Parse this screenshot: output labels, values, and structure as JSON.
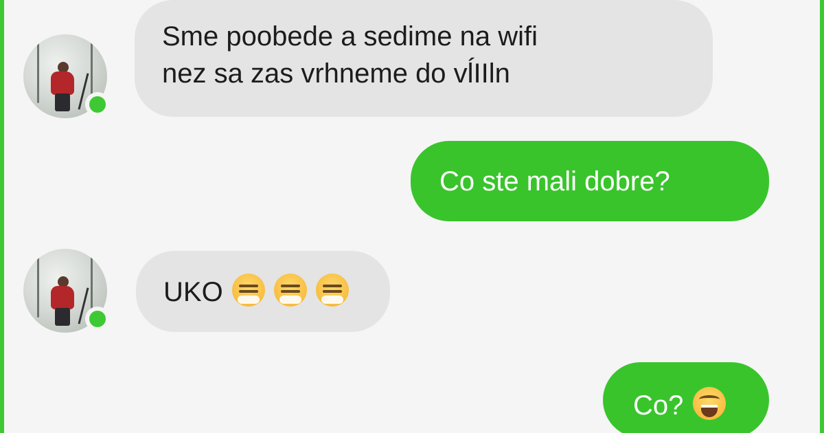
{
  "conversation": {
    "messages": [
      {
        "sender": "contact",
        "lines": [
          "Sme poobede a sedime na wifi",
          "nez sa zas vrhneme do vĺIIln"
        ]
      },
      {
        "sender": "me",
        "lines": [
          "Co ste mali dobre?"
        ]
      },
      {
        "sender": "contact",
        "lines": [
          "UKO"
        ],
        "emojis": [
          "face-with-steam-icon",
          "face-with-steam-icon",
          "face-with-steam-icon"
        ]
      },
      {
        "sender": "me",
        "lines": [
          "Co?"
        ],
        "emojis": [
          "tears-of-joy-icon"
        ]
      }
    ]
  },
  "colors": {
    "outgoing_bubble": "#39c42c",
    "incoming_bubble": "#e4e4e4",
    "online_indicator": "#3ec934",
    "frame_border": "#3ec934"
  }
}
